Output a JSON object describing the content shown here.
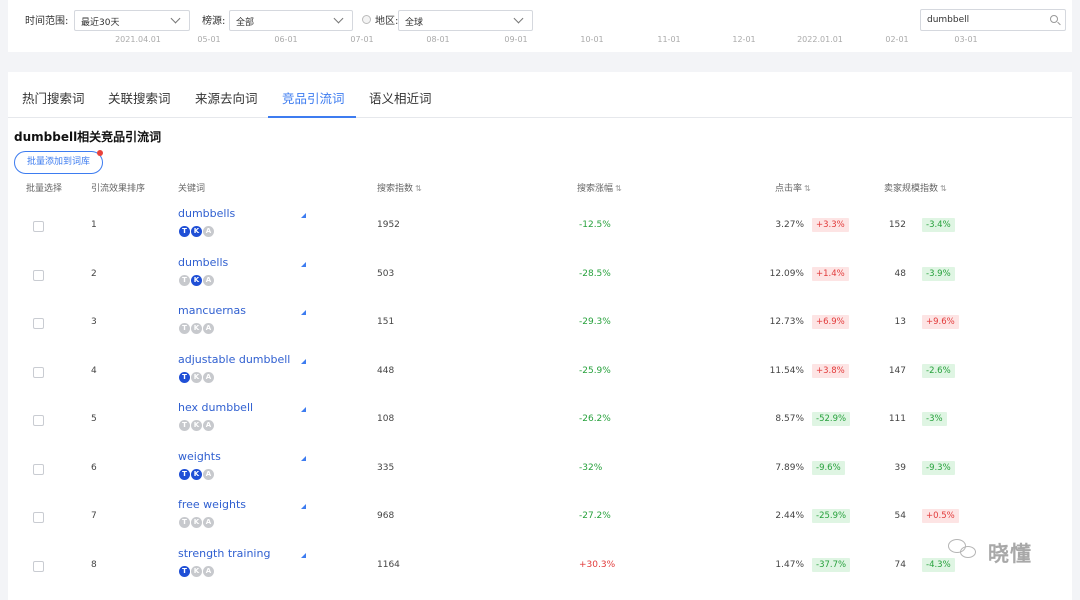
{
  "filters": {
    "time_label": "时间范围:",
    "time_value": "最近30天",
    "category_label": "榜源:",
    "category_value": "全部",
    "region_label": "地区:",
    "region_value": "全球",
    "search_value": "dumbbell"
  },
  "axis_labels": [
    "2021.04.01",
    "05-01",
    "06-01",
    "07-01",
    "08-01",
    "09-01",
    "10-01",
    "11-01",
    "12-01",
    "2022.01.01",
    "02-01",
    "03-01"
  ],
  "tabs": [
    "热门搜索词",
    "关联搜索词",
    "来源去向词",
    "竞品引流词",
    "语义相近词"
  ],
  "active_tab": 3,
  "section_title": "dumbbell相关竞品引流词",
  "batch_button": "批量添加到词库",
  "table": {
    "headers": {
      "select": "批量选择",
      "rank": "引流效果排序",
      "keyword": "关键词",
      "volume": "搜索指数",
      "growth": "搜索涨幅",
      "ctr": "点击率",
      "sellers": "卖家规模指数"
    },
    "sort_glyph": "⇅",
    "rows": [
      {
        "rank": "1",
        "keyword": "dumbbells",
        "badges": [
          1,
          1,
          0
        ],
        "volume": "1952",
        "growth": "-12.5%",
        "growth_dir": "down",
        "ctr": "3.27%",
        "ctr_change": "+3.3%",
        "ctr_dir": "up",
        "sellers": "152",
        "sellers_change": "-3.4%",
        "sellers_dir": "down"
      },
      {
        "rank": "2",
        "keyword": "dumbells",
        "badges": [
          0,
          1,
          0
        ],
        "volume": "503",
        "growth": "-28.5%",
        "growth_dir": "down",
        "ctr": "12.09%",
        "ctr_change": "+1.4%",
        "ctr_dir": "up",
        "sellers": "48",
        "sellers_change": "-3.9%",
        "sellers_dir": "down"
      },
      {
        "rank": "3",
        "keyword": "mancuernas",
        "badges": [
          0,
          0,
          0
        ],
        "volume": "151",
        "growth": "-29.3%",
        "growth_dir": "down",
        "ctr": "12.73%",
        "ctr_change": "+6.9%",
        "ctr_dir": "up",
        "sellers": "13",
        "sellers_change": "+9.6%",
        "sellers_dir": "up"
      },
      {
        "rank": "4",
        "keyword": "adjustable dumbbell",
        "badges": [
          1,
          0,
          0
        ],
        "volume": "448",
        "growth": "-25.9%",
        "growth_dir": "down",
        "ctr": "11.54%",
        "ctr_change": "+3.8%",
        "ctr_dir": "up",
        "sellers": "147",
        "sellers_change": "-2.6%",
        "sellers_dir": "down"
      },
      {
        "rank": "5",
        "keyword": "hex dumbbell",
        "badges": [
          0,
          0,
          0
        ],
        "volume": "108",
        "growth": "-26.2%",
        "growth_dir": "down",
        "ctr": "8.57%",
        "ctr_change": "-52.9%",
        "ctr_dir": "down",
        "sellers": "111",
        "sellers_change": "-3%",
        "sellers_dir": "down"
      },
      {
        "rank": "6",
        "keyword": "weights",
        "badges": [
          1,
          1,
          0
        ],
        "volume": "335",
        "growth": "-32%",
        "growth_dir": "down",
        "ctr": "7.89%",
        "ctr_change": "-9.6%",
        "ctr_dir": "down",
        "sellers": "39",
        "sellers_change": "-9.3%",
        "sellers_dir": "down"
      },
      {
        "rank": "7",
        "keyword": "free weights",
        "badges": [
          0,
          0,
          0
        ],
        "volume": "968",
        "growth": "-27.2%",
        "growth_dir": "down",
        "ctr": "2.44%",
        "ctr_change": "-25.9%",
        "ctr_dir": "down",
        "sellers": "54",
        "sellers_change": "+0.5%",
        "sellers_dir": "up"
      },
      {
        "rank": "8",
        "keyword": "strength training",
        "badges": [
          1,
          0,
          0
        ],
        "volume": "1164",
        "growth": "+30.3%",
        "growth_dir": "up",
        "ctr": "1.47%",
        "ctr_change": "-37.7%",
        "ctr_dir": "down",
        "sellers": "74",
        "sellers_change": "-4.3%",
        "sellers_dir": "down"
      }
    ]
  },
  "badge_letters": [
    "T",
    "K",
    "A"
  ],
  "watermark": "晓懂",
  "colors": {
    "accent": "#3d7cf0",
    "up": "#e23b3b",
    "down": "#27a13c"
  }
}
